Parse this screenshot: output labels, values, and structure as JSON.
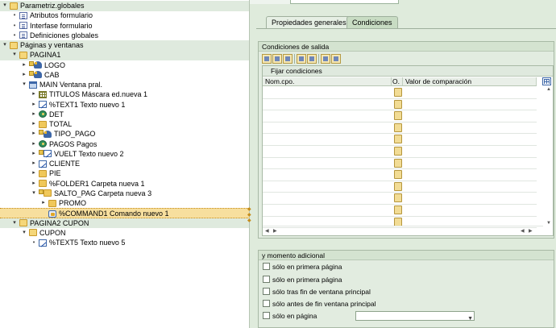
{
  "tree": [
    {
      "label": "Parametriz.globales",
      "icon": "folder-open-icon",
      "toggle": "▾",
      "indent": 0,
      "band": true
    },
    {
      "label": "Atributos formulario",
      "icon": "document-icon",
      "toggle": "•",
      "indent": 1
    },
    {
      "label": "Interfase formulario",
      "icon": "document-icon",
      "toggle": "•",
      "indent": 1
    },
    {
      "label": "Definiciones globales",
      "icon": "document-icon",
      "toggle": "•",
      "indent": 1
    },
    {
      "label": "Páginas y ventanas",
      "icon": "folder-open-icon",
      "toggle": "▾",
      "indent": 0,
      "band": true
    },
    {
      "label": "PAGINA1",
      "icon": "folder-open-icon",
      "toggle": "▾",
      "indent": 1,
      "band": true
    },
    {
      "label": "LOGO",
      "icon": "node-icon",
      "toggle": "▸",
      "indent": 2
    },
    {
      "label": "CAB",
      "icon": "node-icon",
      "toggle": "▸",
      "indent": 2
    },
    {
      "label": "MAIN Ventana pral.",
      "icon": "window-icon",
      "toggle": "▾",
      "indent": 2
    },
    {
      "label": "TITULOS Máscara ed.nueva 1",
      "icon": "grid-icon",
      "toggle": "▸",
      "indent": 3
    },
    {
      "label": "%TEXT1 Texto nuevo 1",
      "icon": "text-icon",
      "toggle": "▸",
      "indent": 3
    },
    {
      "label": "DET",
      "icon": "loop-icon",
      "toggle": "▸",
      "indent": 3
    },
    {
      "label": "TOTAL",
      "icon": "folder-icon",
      "toggle": "▸",
      "indent": 3
    },
    {
      "label": "TIPO_PAGO",
      "icon": "node-icon",
      "toggle": "▸",
      "indent": 3
    },
    {
      "label": "PAGOS Pagos",
      "icon": "loop-icon",
      "toggle": "▸",
      "indent": 3
    },
    {
      "label": "VUELT Texto nuevo 2",
      "icon": "text-node-icon",
      "toggle": "▸",
      "indent": 3
    },
    {
      "label": "CLIENTE",
      "icon": "text-icon",
      "toggle": "▸",
      "indent": 3
    },
    {
      "label": "PIE",
      "icon": "folder-icon",
      "toggle": "▸",
      "indent": 3
    },
    {
      "label": "%FOLDER1 Carpeta nueva 1",
      "icon": "folder-icon",
      "toggle": "▸",
      "indent": 3
    },
    {
      "label": "SALTO_PAG Carpeta nueva 3",
      "icon": "folder-node-icon",
      "toggle": "▾",
      "indent": 3
    },
    {
      "label": "PROMO",
      "icon": "folder-icon",
      "toggle": "▸",
      "indent": 4
    },
    {
      "label": "%COMMAND1 Comando nuevo 1",
      "icon": "command-icon",
      "toggle": "",
      "indent": 4,
      "selected": true
    },
    {
      "label": "PAGINA2 CUPON",
      "icon": "folder-open-icon",
      "toggle": "▾",
      "indent": 1,
      "band": true
    },
    {
      "label": "CUPON",
      "icon": "folder-open-icon",
      "toggle": "▾",
      "indent": 2
    },
    {
      "label": "%TEXT5 Texto nuevo 5",
      "icon": "text-icon",
      "toggle": "•",
      "indent": 3
    }
  ],
  "tabs": [
    {
      "label": "Propiedades generales",
      "active": false
    },
    {
      "label": "Condiciones",
      "active": true
    }
  ],
  "conditions": {
    "title": "Condiciones de salida",
    "toolbar_icons": [
      "cut-icon",
      "copy-icon",
      "paste-icon",
      "insert-row-icon",
      "delete-row-icon",
      "check-icon",
      "list-icon"
    ],
    "grid_caption": "Fijar condiciones",
    "columns": [
      "Nom.cpo.",
      "O.",
      "Valor de comparación"
    ],
    "rows": 12
  },
  "additional": {
    "title": "y momento adicional",
    "options": [
      "sólo en primera página",
      "sólo en primera página",
      "sólo tras fin de ventana principal",
      "sólo antes de fin ventana principal",
      "sólo en página"
    ],
    "page_select_value": ""
  }
}
